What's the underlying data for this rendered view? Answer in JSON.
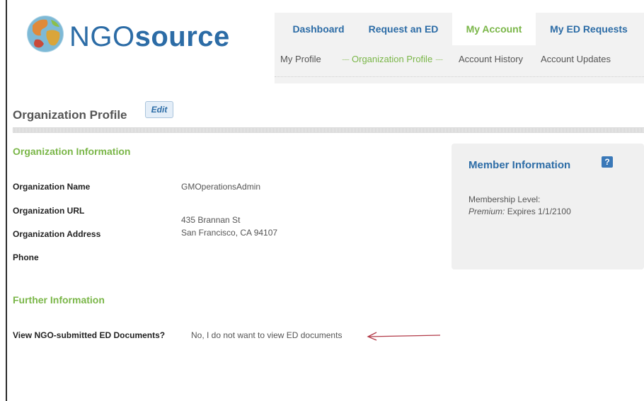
{
  "brand": {
    "part1": "NGO",
    "part2": "source"
  },
  "nav": {
    "tabs": [
      {
        "label": "Dashboard",
        "active": false
      },
      {
        "label": "Request an ED",
        "active": false
      },
      {
        "label": "My Account",
        "active": true
      },
      {
        "label": "My ED Requests",
        "active": false
      }
    ],
    "subtabs": [
      {
        "label": "My Profile",
        "active": false
      },
      {
        "label": "Organization Profile",
        "active": true
      },
      {
        "label": "Account History",
        "active": false
      },
      {
        "label": "Account Updates",
        "active": false
      }
    ]
  },
  "page": {
    "title": "Organization Profile",
    "edit_label": "Edit"
  },
  "org_info": {
    "title": "Organization Information",
    "fields": {
      "name_label": "Organization Name",
      "name_value": "GMOperationsAdmin",
      "url_label": "Organization URL",
      "url_value": "",
      "address_label": "Organization Address",
      "address_line1": "435 Brannan St",
      "address_line2": "San Francisco, CA 94107",
      "phone_label": "Phone",
      "phone_value": ""
    }
  },
  "further_info": {
    "title": "Further Information",
    "question_label": "View NGO-submitted ED Documents?",
    "question_value": "No, I do not want to view ED documents"
  },
  "member_info": {
    "title": "Member Information",
    "help_glyph": "?",
    "level_label": "Membership Level:",
    "level_value": "Premium:",
    "expires_text": "Expires 1/1/2100"
  },
  "colors": {
    "brand_blue": "#2c6ca6",
    "accent_green": "#7ab648",
    "annotation_arrow": "#b23a48"
  }
}
